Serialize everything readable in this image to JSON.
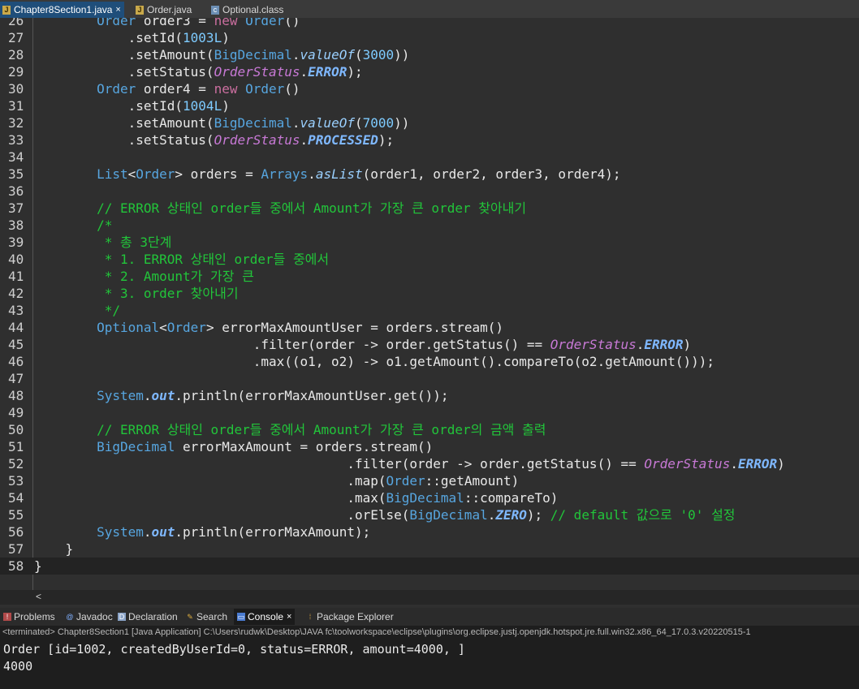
{
  "editor_tabs": [
    {
      "label": "Chapter8Section1.java",
      "icon": "java-file-icon",
      "active": true
    },
    {
      "label": "Order.java",
      "icon": "java-file-icon",
      "active": false
    },
    {
      "label": "Optional.class",
      "icon": "class-file-icon",
      "active": false
    }
  ],
  "editor": {
    "line_numbers": [
      "26",
      "27",
      "28",
      "29",
      "30",
      "31",
      "32",
      "33",
      "34",
      "35",
      "36",
      "37",
      "38",
      "39",
      "40",
      "41",
      "42",
      "43",
      "44",
      "45",
      "46",
      "47",
      "48",
      "49",
      "50",
      "51",
      "52",
      "53",
      "54",
      "55",
      "56",
      "57",
      "58"
    ],
    "lines": [
      "        Order order3 = new Order()",
      "            .setId(1003L)",
      "            .setAmount(BigDecimal.valueOf(3000))",
      "            .setStatus(OrderStatus.ERROR);",
      "        Order order4 = new Order()",
      "            .setId(1004L)",
      "            .setAmount(BigDecimal.valueOf(7000))",
      "            .setStatus(OrderStatus.PROCESSED);",
      "",
      "        List<Order> orders = Arrays.asList(order1, order2, order3, order4);",
      "",
      "        // ERROR 상태인 order들 중에서 Amount가 가장 큰 order 찾아내기",
      "        /*",
      "         * 총 3단계",
      "         * 1. ERROR 상태인 order들 중에서",
      "         * 2. Amount가 가장 큰",
      "         * 3. order 찾아내기",
      "         */",
      "        Optional<Order> errorMaxAmountUser = orders.stream()",
      "                            .filter(order -> order.getStatus() == OrderStatus.ERROR)",
      "                            .max((o1, o2) -> o1.getAmount().compareTo(o2.getAmount()));",
      "",
      "        System.out.println(errorMaxAmountUser.get());",
      "",
      "        // ERROR 상태인 order들 중에서 Amount가 가장 큰 order의 금액 출력",
      "        BigDecimal errorMaxAmount = orders.stream()",
      "                                        .filter(order -> order.getStatus() == OrderStatus.ERROR)",
      "                                        .map(Order::getAmount)",
      "                                        .max(BigDecimal::compareTo)",
      "                                        .orElse(BigDecimal.ZERO); // default 값으로 '0' 설정",
      "        System.out.println(errorMaxAmount);",
      "    }",
      "}"
    ]
  },
  "hscroll": {
    "arrow": "<"
  },
  "view_tabs": [
    {
      "label": "Problems",
      "icon": "problems-icon",
      "active": false
    },
    {
      "label": "Javadoc",
      "icon": "javadoc-icon",
      "active": false
    },
    {
      "label": "Declaration",
      "icon": "declaration-icon",
      "active": false
    },
    {
      "label": "Search",
      "icon": "search-icon",
      "active": false
    },
    {
      "label": "Console",
      "icon": "console-icon",
      "active": true
    },
    {
      "label": "Package Explorer",
      "icon": "package-explorer-icon",
      "active": false
    }
  ],
  "console": {
    "terminated_line": "<terminated> Chapter8Section1 [Java Application] C:\\Users\\rudwk\\Desktop\\JAVA fc\\toolworkspace\\eclipse\\plugins\\org.eclipse.justj.openjdk.hotspot.jre.full.win32.x86_64_17.0.3.v20220515-1",
    "output": [
      "Order [id=1002, createdByUserId=0, status=ERROR, amount=4000, ]",
      "4000"
    ]
  },
  "colors": {
    "editor_bg": "#2f2f2f",
    "comment": "#22c53a",
    "type": "#57a6e0",
    "keyword": "#cc6fa0",
    "active_tab": "#1f4e7a"
  }
}
